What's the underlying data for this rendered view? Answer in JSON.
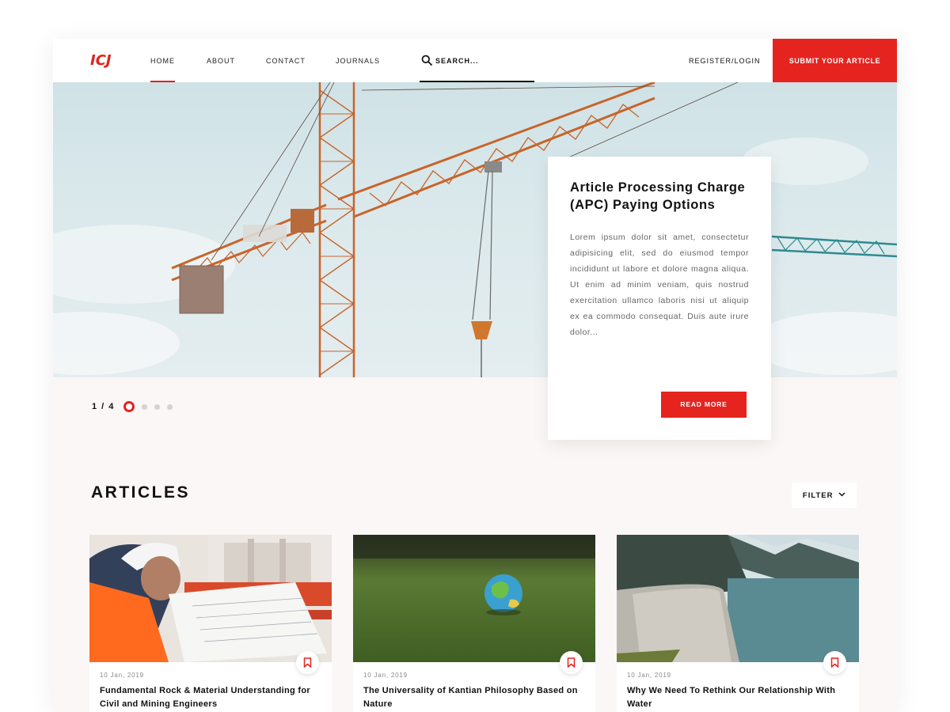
{
  "header": {
    "logo": "ICJ",
    "nav": [
      {
        "label": "HOME",
        "active": true
      },
      {
        "label": "ABOUT",
        "active": false
      },
      {
        "label": "CONTACT",
        "active": false
      },
      {
        "label": "JOURNALS",
        "active": false
      }
    ],
    "search_placeholder": "SEARCH...",
    "register_label": "REGISTER/LOGIN",
    "submit_label": "SUBMIT YOUR ARTICLE"
  },
  "hero": {
    "title": "Article Processing Charge (APC) Paying Options",
    "body": "Lorem ipsum dolor sit amet, consectetur adipisicing elit, sed do eiusmod tempor incididunt ut labore et dolore magna aliqua. Ut enim ad minim veniam, quis nostrud exercitation ullamco laboris nisi ut aliquip ex ea commodo consequat. Duis aute irure dolor...",
    "cta_label": "READ MORE",
    "pager": "1 / 4",
    "slides_total": 4,
    "slide_active": 1
  },
  "articles": {
    "heading": "ARTICLES",
    "filter_label": "FILTER",
    "items": [
      {
        "date": "10 Jan, 2019",
        "title": "Fundamental Rock & Material Understanding for Civil and Mining Engineers"
      },
      {
        "date": "10 Jan, 2019",
        "title": "The Universality of Kantian Philosophy Based on Nature"
      },
      {
        "date": "10 Jan, 2019",
        "title": "Why We Need To Rethink Our Relationship With Water"
      }
    ]
  },
  "colors": {
    "accent": "#e52420",
    "background": "#fbf7f6",
    "crane": "#c8642a"
  },
  "icons": [
    "search-icon",
    "bookmark-icon",
    "chevron-down-icon"
  ]
}
